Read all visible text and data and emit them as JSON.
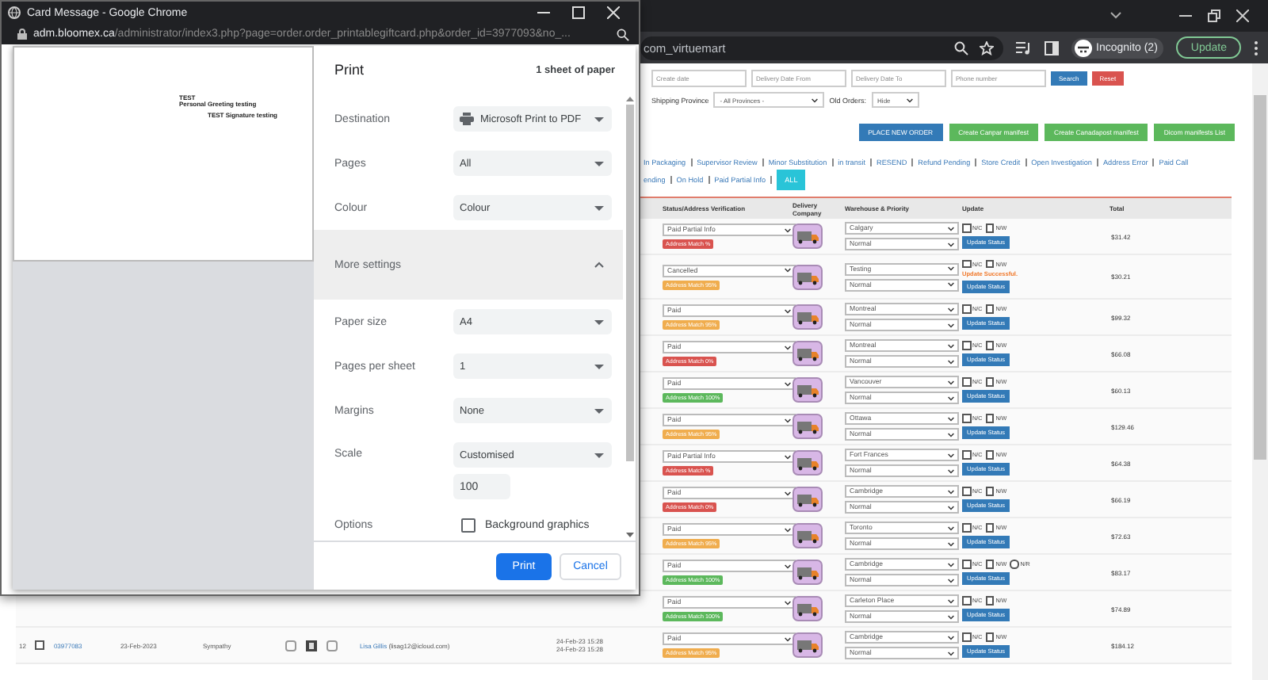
{
  "browser": {
    "address_text": "com_virtuemart",
    "profile_label": "Incognito (2)",
    "update_button": "Update"
  },
  "popup": {
    "title": "Card Message - Google Chrome",
    "url_host": "adm.bloomex.ca",
    "url_path": "/administrator/index3.php?page=order.order_printablegiftcard.php&order_id=3977093&no_...",
    "preview_lines": [
      "TEST",
      "Personal Greeting testing",
      "TEST Signature testing"
    ],
    "print_dialog": {
      "title": "Print",
      "sheet_count": "1 sheet of paper",
      "settings": [
        {
          "kind": "select",
          "label": "Destination",
          "value": "Microsoft Print to PDF",
          "printer": true
        },
        {
          "kind": "select",
          "label": "Pages",
          "value": "All",
          "printer": false
        },
        {
          "kind": "select",
          "label": "Colour",
          "value": "Colour",
          "printer": false
        },
        {
          "kind": "section",
          "label": "More settings",
          "expanded": true
        },
        {
          "kind": "select",
          "label": "Paper size",
          "value": "A4",
          "printer": false
        },
        {
          "kind": "select",
          "label": "Pages per sheet",
          "value": "1",
          "printer": false
        },
        {
          "kind": "select",
          "label": "Margins",
          "value": "None",
          "printer": false
        },
        {
          "kind": "select",
          "label": "Scale",
          "value": "Customised",
          "printer": false,
          "field_value": "100"
        },
        {
          "kind": "checkbox",
          "label": "Options",
          "value": "Background graphics",
          "checked": false
        }
      ],
      "print_button": "Print",
      "cancel_button": "Cancel"
    }
  },
  "page": {
    "filters": {
      "fields": [
        {
          "placeholder": "Create date"
        },
        {
          "placeholder": "Delivery Date From"
        },
        {
          "placeholder": "Delivery Date To"
        },
        {
          "placeholder": "Phone number"
        }
      ],
      "search_button": "Search",
      "reset_button": "Reset",
      "province_label": "Shipping Province",
      "province_value": "- All Provinces -",
      "old_orders_label": "Old Orders:",
      "old_orders_value": "Hide"
    },
    "actions": [
      {
        "label": "PLACE NEW ORDER",
        "color": "#337ab7"
      },
      {
        "label": "Create Canpar manifest",
        "color": "#5cb85c"
      },
      {
        "label": "Create Canadapost manifest",
        "color": "#5cb85c"
      },
      {
        "label": "Dicom manifests List",
        "color": "#5cb85c"
      }
    ],
    "status_links": [
      {
        "links": [
          {
            "label": "In Packaging",
            "selected": false
          },
          {
            "label": "Supervisor Review",
            "selected": false
          },
          {
            "label": "Minor Substitution",
            "selected": false
          },
          {
            "label": "in transit",
            "selected": false
          },
          {
            "label": "RESEND",
            "selected": false
          },
          {
            "label": "Refund Pending",
            "selected": false
          },
          {
            "label": "Store Credit",
            "selected": false
          },
          {
            "label": "Open Investigation",
            "selected": false
          },
          {
            "label": "Address Error",
            "selected": false
          },
          {
            "label": "Paid Call",
            "selected": false
          }
        ]
      },
      {
        "links": [
          {
            "label": "ending",
            "selected": false
          },
          {
            "label": "On Hold",
            "selected": false
          },
          {
            "label": "Paid Partial Info",
            "selected": false
          },
          {
            "label": "ALL",
            "selected": true
          }
        ]
      }
    ],
    "table": {
      "columns": [
        "Status/Address Verification",
        "Delivery Company",
        "Warehouse & Priority",
        "Update",
        "Total"
      ],
      "rows": [
        {
          "status": "Paid Partial Info",
          "match": {
            "label": "Address Match %",
            "color": "#d9534f"
          },
          "warehouse": "Calgary",
          "priority": "Normal",
          "options": [
            {
              "kind": "checkbox",
              "label": "N/C",
              "checked": false
            },
            {
              "kind": "checkbox",
              "label": "N/W",
              "checked": false
            }
          ],
          "button": "Update Status",
          "total": "$31.42"
        },
        {
          "status": "Cancelled",
          "match": {
            "label": "Address Match 95%",
            "color": "#f0ad4e"
          },
          "warehouse": "Testing",
          "priority": "Normal",
          "options": [
            {
              "kind": "checkbox",
              "label": "N/C",
              "checked": false
            },
            {
              "kind": "checkbox",
              "label": "N/W",
              "checked": false
            }
          ],
          "note": "Update Successful.",
          "button": "Update Status",
          "total": "$30.21"
        },
        {
          "status": "Paid",
          "match": {
            "label": "Address Match 95%",
            "color": "#f0ad4e"
          },
          "warehouse": "Montreal",
          "priority": "Normal",
          "options": [
            {
              "kind": "checkbox",
              "label": "N/C",
              "checked": false
            },
            {
              "kind": "checkbox",
              "label": "N/W",
              "checked": false
            }
          ],
          "button": "Update Status",
          "total": "$99.32"
        },
        {
          "status": "Paid",
          "match": {
            "label": "Address Match 0%",
            "color": "#d9534f"
          },
          "warehouse": "Montreal",
          "priority": "Normal",
          "options": [
            {
              "kind": "checkbox",
              "label": "N/C",
              "checked": false
            },
            {
              "kind": "checkbox",
              "label": "N/W",
              "checked": false
            }
          ],
          "button": "Update Status",
          "total": "$66.08"
        },
        {
          "status": "Paid",
          "match": {
            "label": "Address Match 100%",
            "color": "#5cb85c"
          },
          "warehouse": "Vancouver",
          "priority": "Normal",
          "options": [
            {
              "kind": "checkbox",
              "label": "N/C",
              "checked": false
            },
            {
              "kind": "checkbox",
              "label": "N/W",
              "checked": false
            }
          ],
          "button": "Update Status",
          "total": "$60.13"
        },
        {
          "status": "Paid",
          "match": {
            "label": "Address Match 95%",
            "color": "#f0ad4e"
          },
          "warehouse": "Ottawa",
          "priority": "Normal",
          "options": [
            {
              "kind": "checkbox",
              "label": "N/C",
              "checked": false
            },
            {
              "kind": "checkbox",
              "label": "N/W",
              "checked": false
            }
          ],
          "button": "Update Status",
          "total": "$129.46"
        },
        {
          "status": "Paid Partial Info",
          "match": {
            "label": "Address Match %",
            "color": "#d9534f"
          },
          "warehouse": "Fort Frances",
          "priority": "Normal",
          "options": [
            {
              "kind": "checkbox",
              "label": "N/C",
              "checked": false
            },
            {
              "kind": "checkbox",
              "label": "N/W",
              "checked": false
            }
          ],
          "button": "Update Status",
          "total": "$64.38"
        },
        {
          "status": "Paid",
          "match": {
            "label": "Address Match 0%",
            "color": "#d9534f"
          },
          "warehouse": "Cambridge",
          "priority": "Normal",
          "options": [
            {
              "kind": "checkbox",
              "label": "N/C",
              "checked": false
            },
            {
              "kind": "checkbox",
              "label": "N/W",
              "checked": false
            }
          ],
          "button": "Update Status",
          "total": "$66.19"
        },
        {
          "status": "Paid",
          "match": {
            "label": "Address Match 95%",
            "color": "#f0ad4e"
          },
          "warehouse": "Toronto",
          "priority": "Normal",
          "options": [
            {
              "kind": "checkbox",
              "label": "N/C",
              "checked": false
            },
            {
              "kind": "checkbox",
              "label": "N/W",
              "checked": false
            }
          ],
          "button": "Update Status",
          "total": "$72.63"
        },
        {
          "status": "Paid",
          "match": {
            "label": "Address Match 100%",
            "color": "#5cb85c"
          },
          "warehouse": "Cambridge",
          "priority": "Normal",
          "options": [
            {
              "kind": "checkbox",
              "label": "N/C",
              "checked": false
            },
            {
              "kind": "checkbox",
              "label": "N/W",
              "checked": false
            },
            {
              "kind": "radio",
              "label": "N/R",
              "checked": false
            }
          ],
          "button": "Update Status",
          "total": "$83.17"
        },
        {
          "status": "Paid",
          "match": {
            "label": "Address Match 100%",
            "color": "#5cb85c"
          },
          "warehouse": "Carleton Place",
          "priority": "Normal",
          "options": [
            {
              "kind": "checkbox",
              "label": "N/C",
              "checked": false
            },
            {
              "kind": "checkbox",
              "label": "N/W",
              "checked": false
            }
          ],
          "button": "Update Status",
          "total": "$74.89"
        },
        {
          "status": "Paid",
          "match": {
            "label": "Address Match 95%",
            "color": "#f0ad4e"
          },
          "warehouse": "Cambridge",
          "priority": "Normal",
          "options": [
            {
              "kind": "checkbox",
              "label": "N/C",
              "checked": false
            },
            {
              "kind": "checkbox",
              "label": "N/W",
              "checked": false
            }
          ],
          "button": "Update Status",
          "total": "$184.12",
          "order": {
            "index": "12",
            "checked": false,
            "number": "03977083",
            "date": "23-Feb-2023",
            "occasion": "Sympathy",
            "customer": "Lisa Gillis",
            "email": "(lisag12@icloud.com)",
            "times": [
              "24-Feb-23 15:28",
              "24-Feb-23 15:28"
            ]
          }
        }
      ]
    }
  }
}
